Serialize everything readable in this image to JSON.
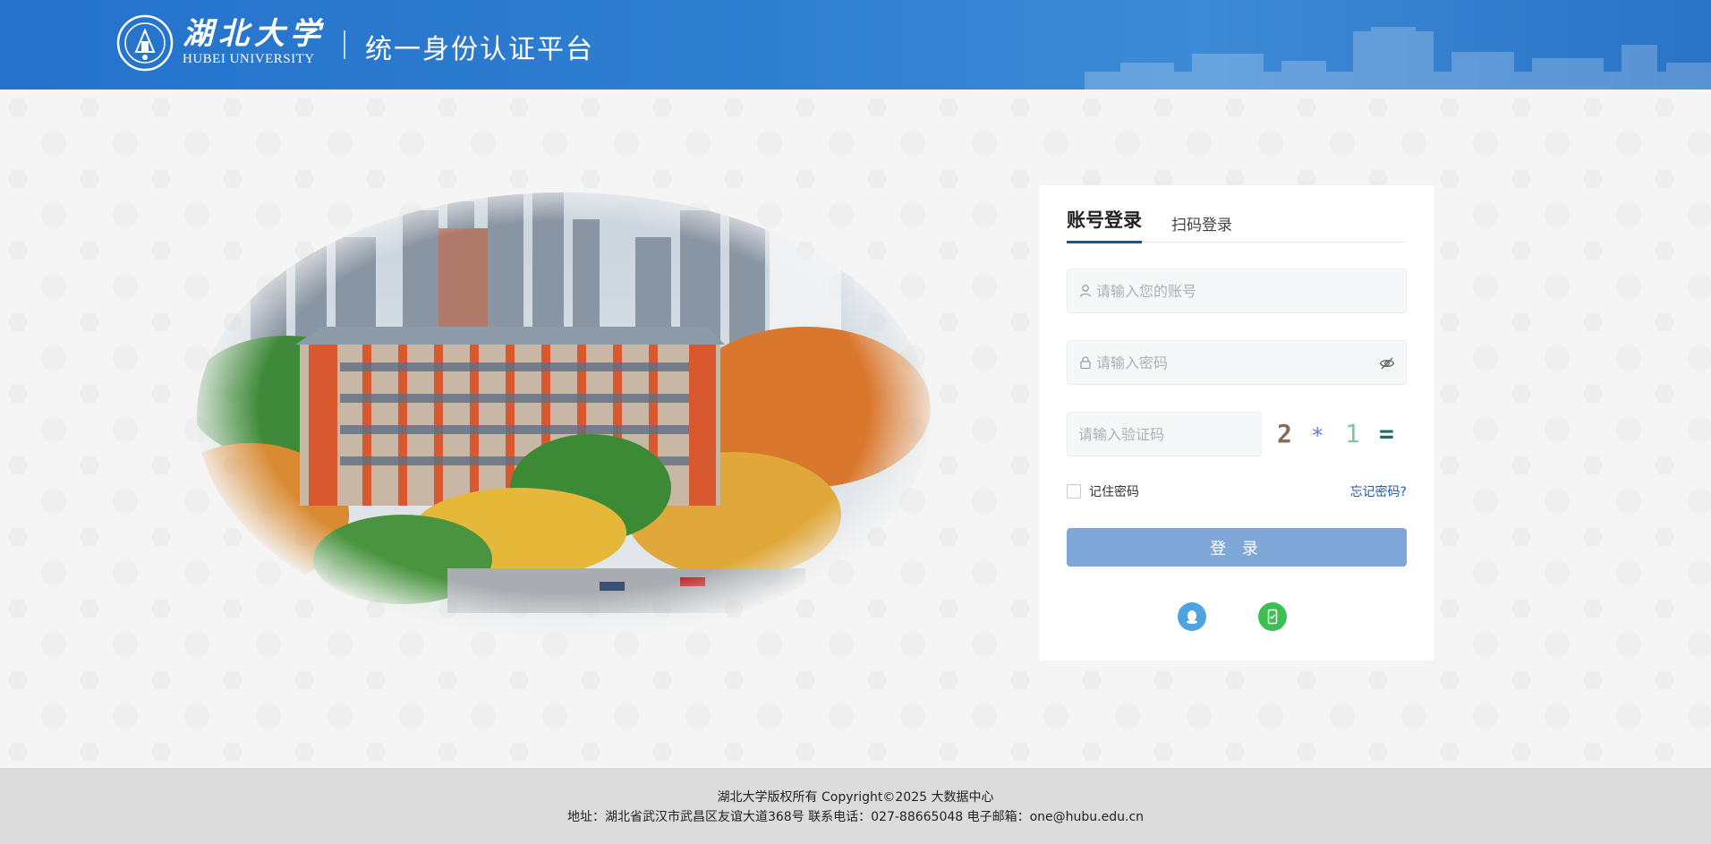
{
  "header": {
    "brand_cn": "湖北大学",
    "brand_en": "HUBEI UNIVERSITY",
    "platform_title": "统一身份认证平台",
    "logo_icon": "university-seal-icon"
  },
  "login": {
    "tabs": [
      {
        "label": "账号登录",
        "active": true
      },
      {
        "label": "扫码登录",
        "active": false
      }
    ],
    "account_placeholder": "请输入您的账号",
    "password_placeholder": "请输入密码",
    "captcha_placeholder": "请输入验证码",
    "captcha": [
      "2",
      "*",
      "1",
      "="
    ],
    "remember_label": "记住密码",
    "forgot_label": "忘记密码?",
    "login_button": "登 录",
    "alt_methods": [
      {
        "icon": "qq-icon",
        "color": "#4fa3e0"
      },
      {
        "icon": "phone-icon",
        "color": "#3cc04f"
      }
    ]
  },
  "footer": {
    "copyright": "湖北大学版权所有 Copyright©2025 大数据中心",
    "address": "地址：湖北省武汉市武昌区友谊大道368号 联系电话：027-88665048 电子邮箱：one@hubu.edu.cn"
  },
  "colors": {
    "header_blue": "#2472cb",
    "primary": "#1d4f9a",
    "button": "#7ea6d6",
    "link": "#1d5aa8"
  }
}
